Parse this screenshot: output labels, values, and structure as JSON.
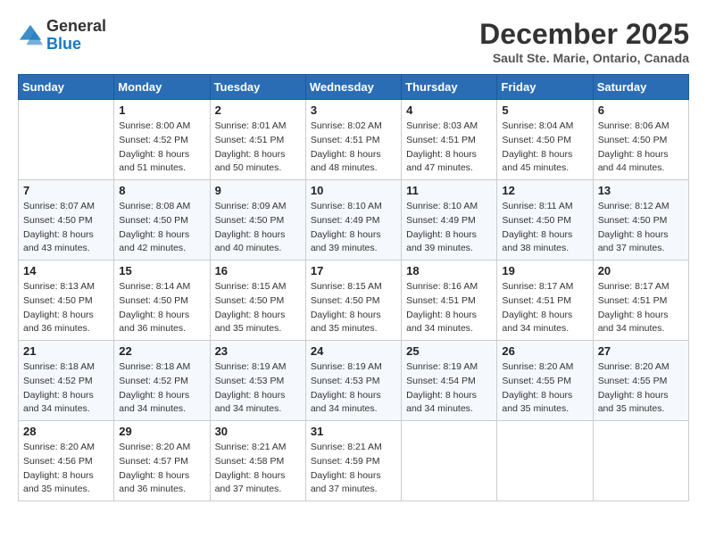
{
  "header": {
    "logo_general": "General",
    "logo_blue": "Blue",
    "month_title": "December 2025",
    "location": "Sault Ste. Marie, Ontario, Canada"
  },
  "weekdays": [
    "Sunday",
    "Monday",
    "Tuesday",
    "Wednesday",
    "Thursday",
    "Friday",
    "Saturday"
  ],
  "weeks": [
    [
      {
        "day": "",
        "info": ""
      },
      {
        "day": "1",
        "info": "Sunrise: 8:00 AM\nSunset: 4:52 PM\nDaylight: 8 hours\nand 51 minutes."
      },
      {
        "day": "2",
        "info": "Sunrise: 8:01 AM\nSunset: 4:51 PM\nDaylight: 8 hours\nand 50 minutes."
      },
      {
        "day": "3",
        "info": "Sunrise: 8:02 AM\nSunset: 4:51 PM\nDaylight: 8 hours\nand 48 minutes."
      },
      {
        "day": "4",
        "info": "Sunrise: 8:03 AM\nSunset: 4:51 PM\nDaylight: 8 hours\nand 47 minutes."
      },
      {
        "day": "5",
        "info": "Sunrise: 8:04 AM\nSunset: 4:50 PM\nDaylight: 8 hours\nand 45 minutes."
      },
      {
        "day": "6",
        "info": "Sunrise: 8:06 AM\nSunset: 4:50 PM\nDaylight: 8 hours\nand 44 minutes."
      }
    ],
    [
      {
        "day": "7",
        "info": "Sunrise: 8:07 AM\nSunset: 4:50 PM\nDaylight: 8 hours\nand 43 minutes."
      },
      {
        "day": "8",
        "info": "Sunrise: 8:08 AM\nSunset: 4:50 PM\nDaylight: 8 hours\nand 42 minutes."
      },
      {
        "day": "9",
        "info": "Sunrise: 8:09 AM\nSunset: 4:50 PM\nDaylight: 8 hours\nand 40 minutes."
      },
      {
        "day": "10",
        "info": "Sunrise: 8:10 AM\nSunset: 4:49 PM\nDaylight: 8 hours\nand 39 minutes."
      },
      {
        "day": "11",
        "info": "Sunrise: 8:10 AM\nSunset: 4:49 PM\nDaylight: 8 hours\nand 39 minutes."
      },
      {
        "day": "12",
        "info": "Sunrise: 8:11 AM\nSunset: 4:50 PM\nDaylight: 8 hours\nand 38 minutes."
      },
      {
        "day": "13",
        "info": "Sunrise: 8:12 AM\nSunset: 4:50 PM\nDaylight: 8 hours\nand 37 minutes."
      }
    ],
    [
      {
        "day": "14",
        "info": "Sunrise: 8:13 AM\nSunset: 4:50 PM\nDaylight: 8 hours\nand 36 minutes."
      },
      {
        "day": "15",
        "info": "Sunrise: 8:14 AM\nSunset: 4:50 PM\nDaylight: 8 hours\nand 36 minutes."
      },
      {
        "day": "16",
        "info": "Sunrise: 8:15 AM\nSunset: 4:50 PM\nDaylight: 8 hours\nand 35 minutes."
      },
      {
        "day": "17",
        "info": "Sunrise: 8:15 AM\nSunset: 4:50 PM\nDaylight: 8 hours\nand 35 minutes."
      },
      {
        "day": "18",
        "info": "Sunrise: 8:16 AM\nSunset: 4:51 PM\nDaylight: 8 hours\nand 34 minutes."
      },
      {
        "day": "19",
        "info": "Sunrise: 8:17 AM\nSunset: 4:51 PM\nDaylight: 8 hours\nand 34 minutes."
      },
      {
        "day": "20",
        "info": "Sunrise: 8:17 AM\nSunset: 4:51 PM\nDaylight: 8 hours\nand 34 minutes."
      }
    ],
    [
      {
        "day": "21",
        "info": "Sunrise: 8:18 AM\nSunset: 4:52 PM\nDaylight: 8 hours\nand 34 minutes."
      },
      {
        "day": "22",
        "info": "Sunrise: 8:18 AM\nSunset: 4:52 PM\nDaylight: 8 hours\nand 34 minutes."
      },
      {
        "day": "23",
        "info": "Sunrise: 8:19 AM\nSunset: 4:53 PM\nDaylight: 8 hours\nand 34 minutes."
      },
      {
        "day": "24",
        "info": "Sunrise: 8:19 AM\nSunset: 4:53 PM\nDaylight: 8 hours\nand 34 minutes."
      },
      {
        "day": "25",
        "info": "Sunrise: 8:19 AM\nSunset: 4:54 PM\nDaylight: 8 hours\nand 34 minutes."
      },
      {
        "day": "26",
        "info": "Sunrise: 8:20 AM\nSunset: 4:55 PM\nDaylight: 8 hours\nand 35 minutes."
      },
      {
        "day": "27",
        "info": "Sunrise: 8:20 AM\nSunset: 4:55 PM\nDaylight: 8 hours\nand 35 minutes."
      }
    ],
    [
      {
        "day": "28",
        "info": "Sunrise: 8:20 AM\nSunset: 4:56 PM\nDaylight: 8 hours\nand 35 minutes."
      },
      {
        "day": "29",
        "info": "Sunrise: 8:20 AM\nSunset: 4:57 PM\nDaylight: 8 hours\nand 36 minutes."
      },
      {
        "day": "30",
        "info": "Sunrise: 8:21 AM\nSunset: 4:58 PM\nDaylight: 8 hours\nand 37 minutes."
      },
      {
        "day": "31",
        "info": "Sunrise: 8:21 AM\nSunset: 4:59 PM\nDaylight: 8 hours\nand 37 minutes."
      },
      {
        "day": "",
        "info": ""
      },
      {
        "day": "",
        "info": ""
      },
      {
        "day": "",
        "info": ""
      }
    ]
  ]
}
